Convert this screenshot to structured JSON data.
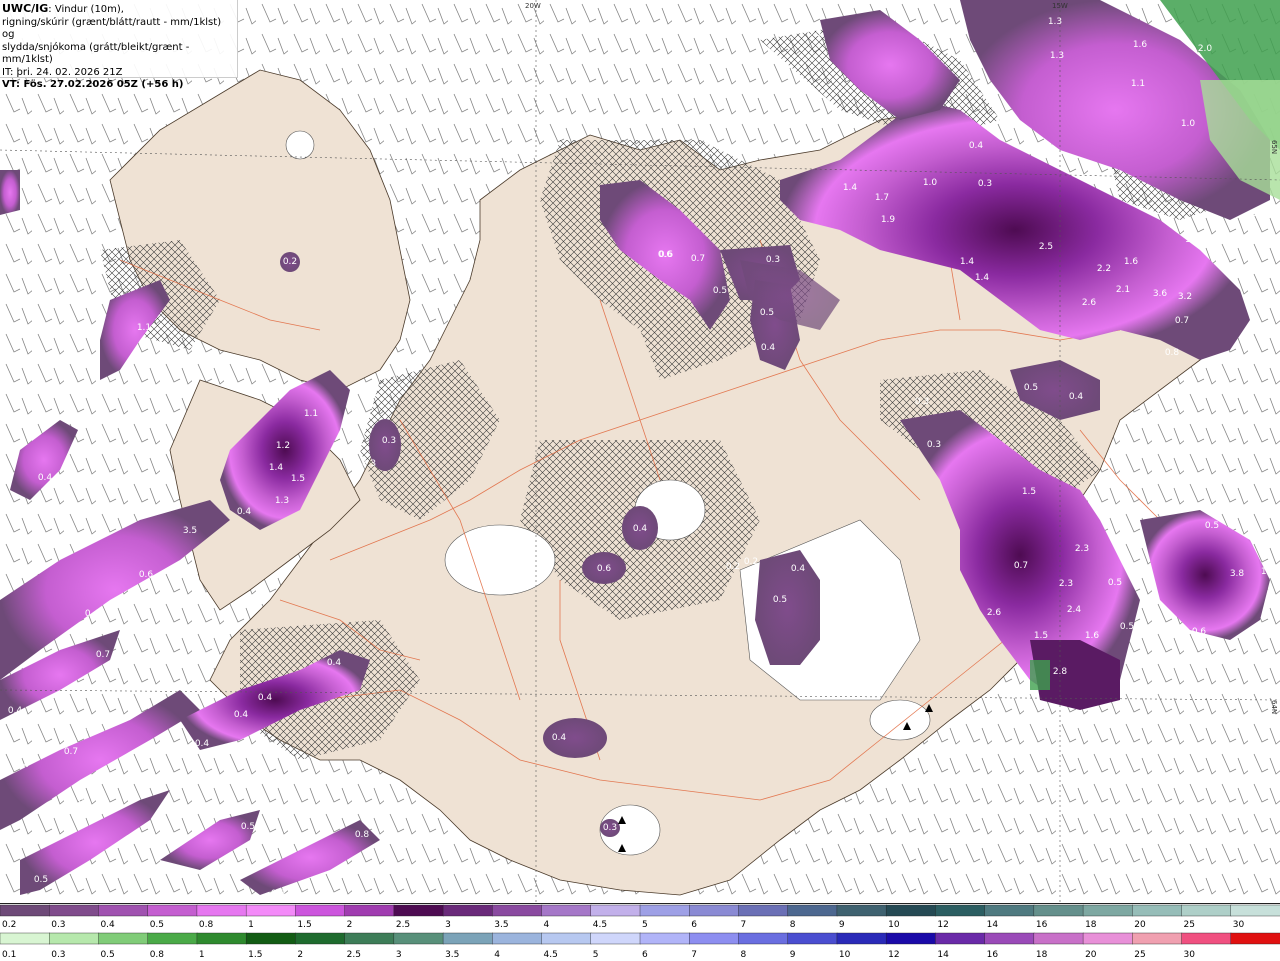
{
  "title": {
    "model": "UWC/IG",
    "description_lines": [
      ": Vindur (10m),",
      "rigning/skúrir (grænt/blátt/rautt - mm/1klst) og",
      "slydda/snjókoma (grátt/bleikt/grænt - mm/1klst)"
    ],
    "initial_time": "IT: þri. 24. 02. 2026 21Z",
    "valid_time": "VT: Fös. 27.02.2026 05Z (+56 h)"
  },
  "grid_labels": {
    "lon_20w": "20W",
    "lon_15w": "15W",
    "lat_65n": "65N",
    "lat_64n": "64N"
  },
  "precip_labels": [
    {
      "t": "0.5"
    },
    {
      "t": "1.3"
    },
    {
      "t": "1.6"
    },
    {
      "t": "2.0"
    },
    {
      "t": "1.3"
    },
    {
      "t": "1.1"
    },
    {
      "t": "1.0"
    },
    {
      "t": "0.6"
    },
    {
      "t": "0.4"
    },
    {
      "t": "0.3"
    },
    {
      "t": "1.0"
    },
    {
      "t": "1.7"
    },
    {
      "t": "1.4"
    },
    {
      "t": "1.9"
    },
    {
      "t": "0.6"
    },
    {
      "t": "2.5"
    },
    {
      "t": "1.4"
    },
    {
      "t": "1.4"
    },
    {
      "t": "2.2"
    },
    {
      "t": "1.6"
    },
    {
      "t": "2.6"
    },
    {
      "t": "2.1"
    },
    {
      "t": "3.6"
    },
    {
      "t": "3.2"
    },
    {
      "t": "1.1"
    },
    {
      "t": "1.2"
    },
    {
      "t": "0.4"
    },
    {
      "t": "0.7"
    },
    {
      "t": "0.8"
    },
    {
      "t": "0.6"
    },
    {
      "t": "0.7"
    },
    {
      "t": "0.3"
    },
    {
      "t": "0.5"
    },
    {
      "t": "0.5"
    },
    {
      "t": "0.4"
    },
    {
      "t": "0.2"
    },
    {
      "t": "1.1"
    },
    {
      "t": "0.5"
    },
    {
      "t": "0.4"
    },
    {
      "t": "0.3"
    },
    {
      "t": "0.3"
    },
    {
      "t": "0.3"
    },
    {
      "t": "0.4"
    },
    {
      "t": "1.5"
    },
    {
      "t": "2.3"
    },
    {
      "t": "2.3"
    },
    {
      "t": "2.4"
    },
    {
      "t": "2.6"
    },
    {
      "t": "1.5"
    },
    {
      "t": "1.6"
    },
    {
      "t": "2.8"
    },
    {
      "t": "0.7"
    },
    {
      "t": "0.5"
    },
    {
      "t": "0.5"
    },
    {
      "t": "3.8"
    },
    {
      "t": "1.3"
    },
    {
      "t": "0.6"
    },
    {
      "t": "0.5"
    },
    {
      "t": "1.1"
    },
    {
      "t": "1.2"
    },
    {
      "t": "1.4"
    },
    {
      "t": "1.5"
    },
    {
      "t": "1.3"
    },
    {
      "t": "0.3"
    },
    {
      "t": "0.4"
    },
    {
      "t": "3.5"
    },
    {
      "t": "0.6"
    },
    {
      "t": "0.4"
    },
    {
      "t": "0.7"
    },
    {
      "t": "0.4"
    },
    {
      "t": "0.7"
    },
    {
      "t": "0.7"
    },
    {
      "t": "0.4"
    },
    {
      "t": "1.0"
    },
    {
      "t": "0.5"
    },
    {
      "t": "0.8"
    },
    {
      "t": "0.8"
    },
    {
      "t": "0.5"
    },
    {
      "t": "0.4"
    },
    {
      "t": "0.4"
    },
    {
      "t": "0.4"
    },
    {
      "t": "0.4"
    },
    {
      "t": "0.4"
    },
    {
      "t": "0.6"
    },
    {
      "t": "0.2"
    },
    {
      "t": "0.2"
    },
    {
      "t": "0.4"
    },
    {
      "t": "0.5"
    },
    {
      "t": "0.4"
    },
    {
      "t": "0.3"
    }
  ],
  "colorbar_snow": {
    "labels": [
      "0.2",
      "0.3",
      "0.4",
      "0.5",
      "0.8",
      "1",
      "1.5",
      "2",
      "2.5",
      "3",
      "3.5",
      "4",
      "4.5",
      "5",
      "6",
      "7",
      "8",
      "9",
      "10",
      "12",
      "14",
      "16",
      "18",
      "20",
      "25",
      "30"
    ],
    "colors": [
      "#6e4a78",
      "#804c8c",
      "#a052b0",
      "#c45ed0",
      "#e677f0",
      "#f38af8",
      "#cc55dd",
      "#a03cb0",
      "#4e0b52",
      "#6a2a7a",
      "#8a4aa0",
      "#a577c8",
      "#c2b0ea",
      "#9ea0e6",
      "#8a8ad4",
      "#6b70b6",
      "#4d6890",
      "#3f6270",
      "#254a54",
      "#2c5e62",
      "#4f7a80",
      "#65908c",
      "#7ea8a2",
      "#96bdb8",
      "#aecfc8",
      "#c7e0da"
    ]
  },
  "colorbar_rain": {
    "labels": [
      "0.1",
      "0.3",
      "0.5",
      "0.8",
      "1",
      "1.5",
      "2",
      "2.5",
      "3",
      "3.5",
      "4",
      "4.5",
      "5",
      "6",
      "7",
      "8",
      "9",
      "10",
      "12",
      "14",
      "16",
      "18",
      "20",
      "25",
      "30"
    ],
    "colors": [
      "#d8f5d2",
      "#b6e8ac",
      "#80cc78",
      "#4aaa48",
      "#2e8a2e",
      "#125c14",
      "#1e6b2e",
      "#3d7d58",
      "#58907a",
      "#7ba3b8",
      "#9bb4dd",
      "#b7c8f0",
      "#cfd6fb",
      "#b1b4f8",
      "#8d8ef0",
      "#6a6ee0",
      "#4a4ed0",
      "#2a2ab8",
      "#1a0aa8",
      "#6a2aa8",
      "#9a4ab8",
      "#c870c8",
      "#e890d8",
      "#f0a0b0",
      "#f05080",
      "#e01010"
    ]
  }
}
